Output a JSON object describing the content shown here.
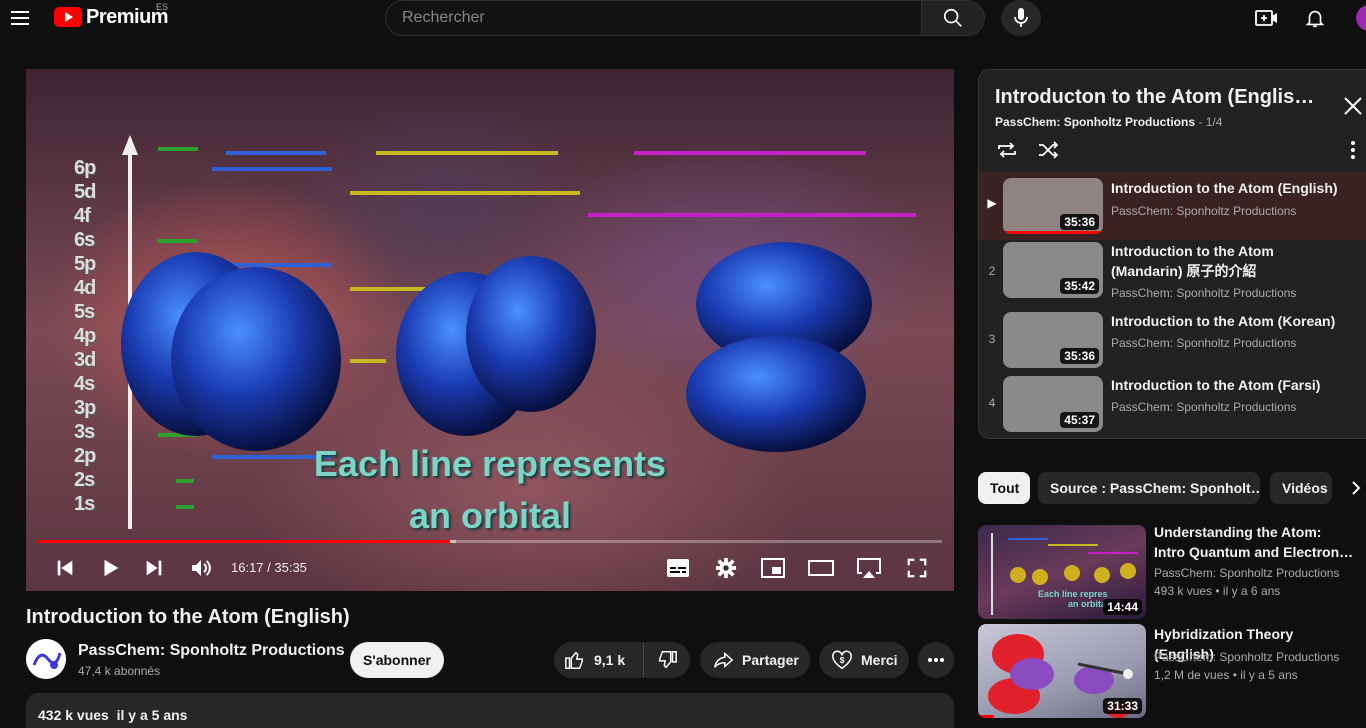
{
  "header": {
    "brand": "Premium",
    "country_code": "ES",
    "search_placeholder": "Rechercher",
    "icons": [
      "menu-icon",
      "youtube-logo-icon",
      "search-icon",
      "mic-icon",
      "create-icon",
      "bell-icon"
    ]
  },
  "player": {
    "overlay_levels": [
      "6p",
      "5d",
      "4f",
      "6s",
      "5p",
      "4d",
      "5s",
      "4p",
      "3d",
      "4s",
      "3p",
      "3s",
      "2p",
      "2s",
      "1s"
    ],
    "subtitle_line1": "Each line represents",
    "subtitle_line2": "an orbital",
    "timecode": "16:17 / 35:35",
    "progress": 0.4558,
    "buffered": 0.4624,
    "accent": "#ff0000"
  },
  "video": {
    "title": "Introduction to the Atom (English)",
    "channel": "PassChem: Sponholtz Productions",
    "subscribers": "47,4 k abonnés",
    "subscribe_label": "S'abonner",
    "likes": "9,1 k",
    "share_label": "Partager",
    "thanks_label": "Merci",
    "views": "432 k vues",
    "age": "il y a 5 ans"
  },
  "playlist": {
    "title": "Introducton to the Atom (English, M...",
    "channel": "PassChem: Sponholtz Productions",
    "position": "- 1/4",
    "items": [
      {
        "index": "▶",
        "title": "Introduction to the Atom (English)",
        "channel": "PassChem: Sponholtz Productions",
        "duration": "35:36"
      },
      {
        "index": "2",
        "title": "Introduction to the Atom (Mandarin) 原子的介紹",
        "channel": "PassChem: Sponholtz Productions",
        "duration": "35:42"
      },
      {
        "index": "3",
        "title": "Introduction to the Atom (Korean)",
        "channel": "PassChem: Sponholtz Productions",
        "duration": "35:36"
      },
      {
        "index": "4",
        "title": "Introduction to the Atom (Farsi)",
        "channel": "PassChem: Sponholtz Productions",
        "duration": "45:37"
      }
    ]
  },
  "chips": [
    "Tout",
    "Source : PassChem: Sponholt…",
    "Vidéos"
  ],
  "recommendations": [
    {
      "title": "Understanding the Atom: Intro Quantum and Electron…",
      "channel": "PassChem: Sponholtz Productions",
      "views": "493 k vues",
      "age": "il y a 6 ans",
      "duration": "14:44",
      "thumb_caption1": "Each line repres",
      "thumb_caption2": "an orbita"
    },
    {
      "title": "Hybridization Theory (English)",
      "channel": "PassChem: Sponholtz Productions",
      "views": "1,2 M de vues",
      "age": "il y a 5 ans",
      "duration": "31:33"
    }
  ]
}
